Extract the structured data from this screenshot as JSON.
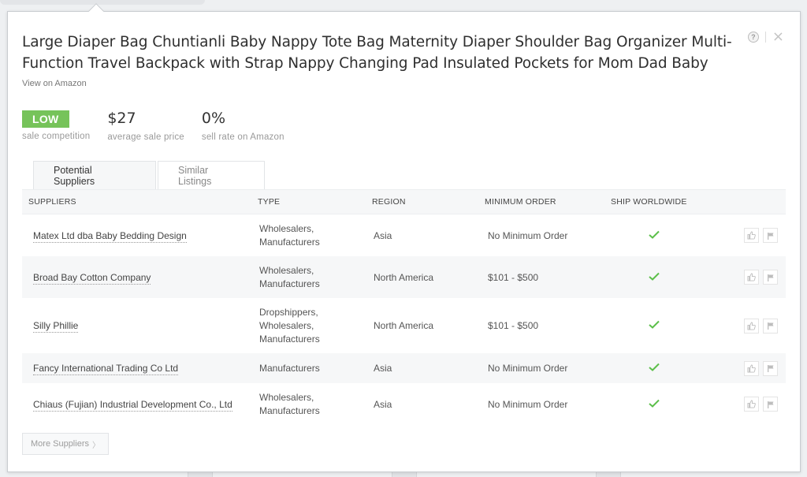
{
  "product": {
    "title": "Large Diaper Bag Chuntianli Baby Nappy Tote Bag Maternity Diaper Shoulder Bag Organizer Multi-Function Travel Backpack with Strap Nappy Changing Pad Insulated Pockets for Mom Dad Baby",
    "view_link": "View on Amazon"
  },
  "header_actions": {
    "help_icon": "?",
    "close_icon": "×"
  },
  "stats": {
    "competition": {
      "value": "LOW",
      "label": "sale competition",
      "color": "#76c35a"
    },
    "price": {
      "value": "$27",
      "label": "average sale price"
    },
    "sell_rate": {
      "value": "0%",
      "label": "sell rate on Amazon"
    }
  },
  "tabs": [
    {
      "label": "Potential Suppliers",
      "active": true
    },
    {
      "label": "Similar Listings",
      "active": false
    }
  ],
  "table": {
    "headers": [
      "SUPPLIERS",
      "TYPE",
      "REGION",
      "MINIMUM ORDER",
      "SHIP WORLDWIDE"
    ],
    "rows": [
      {
        "supplier": "Matex Ltd dba Baby Bedding Design",
        "type": [
          "Wholesalers,",
          "Manufacturers"
        ],
        "region": "Asia",
        "min_order": "No Minimum Order",
        "ship_worldwide": true
      },
      {
        "supplier": "Broad Bay Cotton Company",
        "type": [
          "Wholesalers,",
          "Manufacturers"
        ],
        "region": "North America",
        "min_order": "$101 - $500",
        "ship_worldwide": true
      },
      {
        "supplier": "Silly Phillie",
        "type": [
          "Dropshippers,",
          "Wholesalers,",
          "Manufacturers"
        ],
        "region": "North America",
        "min_order": "$101 - $500",
        "ship_worldwide": true
      },
      {
        "supplier": "Fancy International Trading Co Ltd",
        "type": [
          "Manufacturers"
        ],
        "region": "Asia",
        "min_order": "No Minimum Order",
        "ship_worldwide": true
      },
      {
        "supplier": "Chiaus (Fujian) Industrial Development Co., Ltd",
        "type": [
          "Wholesalers,",
          "Manufacturers"
        ],
        "region": "Asia",
        "min_order": "No Minimum Order",
        "ship_worldwide": true
      }
    ],
    "row_actions": [
      "thumbs-up-icon",
      "flag-icon"
    ],
    "check_color": "#5cbf4a"
  },
  "more_button": {
    "label": "More Suppliers",
    "chevron": "〉"
  }
}
